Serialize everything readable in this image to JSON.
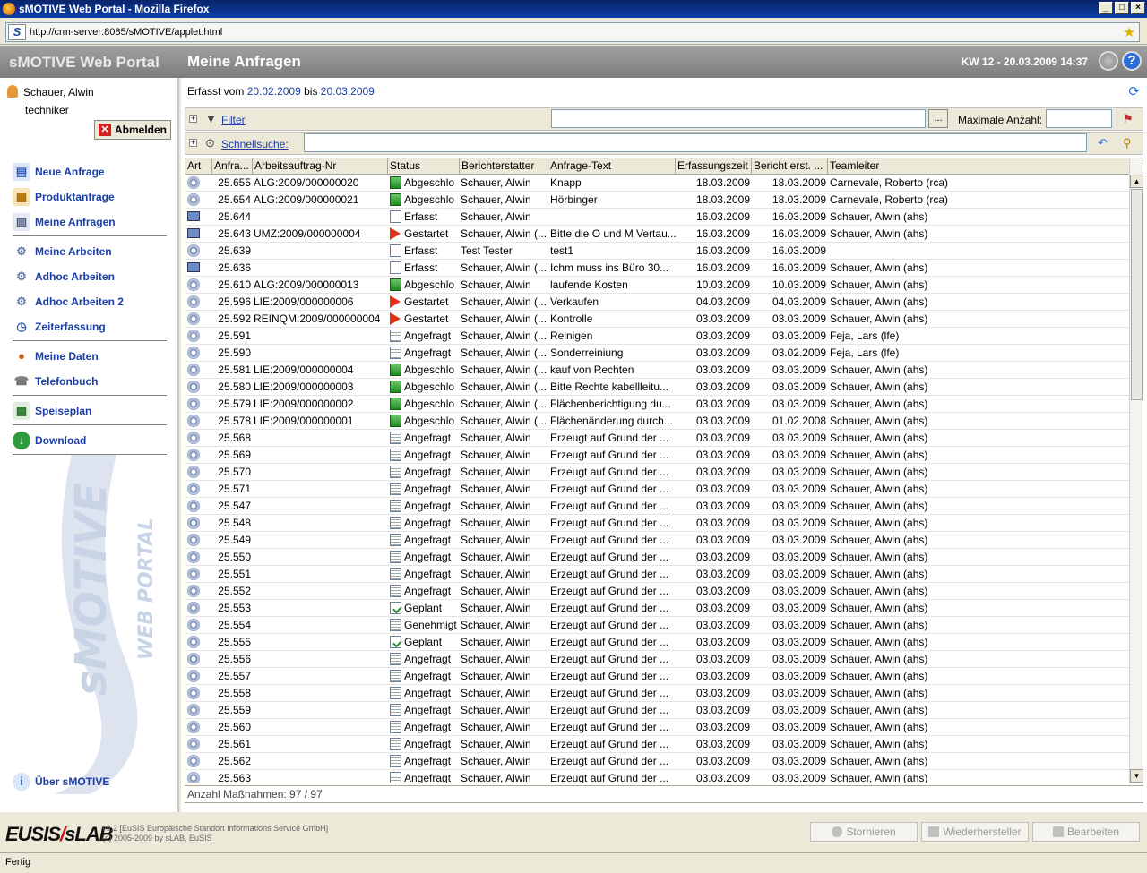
{
  "window": {
    "title": "sMOTIVE Web Portal - Mozilla Firefox"
  },
  "browser": {
    "url": "http://crm-server:8085/sMOTIVE/applet.html",
    "status": "Fertig"
  },
  "app": {
    "brand": "sMOTIVE Web Portal",
    "page_title": "Meine Anfragen",
    "date_info": "KW 12 - 20.03.2009 14:37"
  },
  "user": {
    "name": "Schauer, Alwin",
    "role": "techniker",
    "logout_label": "Abmelden"
  },
  "nav": [
    {
      "label": "Neue Anfrage",
      "icon": "new-request-icon"
    },
    {
      "label": "Produktanfrage",
      "icon": "product-request-icon"
    },
    {
      "label": "Meine Anfragen",
      "icon": "my-requests-icon"
    },
    {
      "label": "Meine Arbeiten",
      "icon": "gears-icon"
    },
    {
      "label": "Adhoc Arbeiten",
      "icon": "gears-icon"
    },
    {
      "label": "Adhoc Arbeiten 2",
      "icon": "gears-icon"
    },
    {
      "label": "Zeiterfassung",
      "icon": "clock-icon"
    },
    {
      "label": "Meine Daten",
      "icon": "person-icon"
    },
    {
      "label": "Telefonbuch",
      "icon": "phonebook-icon"
    },
    {
      "label": "Speiseplan",
      "icon": "menu-plan-icon"
    },
    {
      "label": "Download",
      "icon": "download-icon"
    }
  ],
  "about_label": "Über sMOTIVE",
  "range": {
    "prefix": "Erfasst vom",
    "from": "20.02.2009",
    "mid": "bis",
    "to": "20.03.2009"
  },
  "filter": {
    "label": "Filter",
    "browse": "...",
    "max_label": "Maximale Anzahl:",
    "max_value": ""
  },
  "quicksearch": {
    "label": "Schnellsuche:",
    "value": ""
  },
  "columns": [
    "Art",
    "Anfra...",
    "Arbeitsauftrag-Nr",
    "Status",
    "Berichterstatter",
    "Anfrage-Text",
    "Erfassungszeit",
    "Bericht erst. ...",
    "Teamleiter"
  ],
  "rows": [
    {
      "art": "gear",
      "nr": "25.655",
      "auftrag": "ALG:2009/000000020",
      "status_icon": "green",
      "status": "Abgeschlo",
      "reporter": "Schauer, Alwin",
      "text": "Knapp",
      "erfasst": "18.03.2009",
      "bericht": "18.03.2009",
      "leiter": "Carnevale, Roberto (rca)"
    },
    {
      "art": "gear",
      "nr": "25.654",
      "auftrag": "ALG:2009/000000021",
      "status_icon": "green",
      "status": "Abgeschlo",
      "reporter": "Schauer, Alwin",
      "text": "Hörbinger",
      "erfasst": "18.03.2009",
      "bericht": "18.03.2009",
      "leiter": "Carnevale, Roberto (rca)"
    },
    {
      "art": "pc",
      "nr": "25.644",
      "auftrag": "",
      "status_icon": "doc",
      "status": "Erfasst",
      "reporter": "Schauer, Alwin",
      "text": "",
      "erfasst": "16.03.2009",
      "bericht": "16.03.2009",
      "leiter": "Schauer, Alwin (ahs)"
    },
    {
      "art": "pc",
      "nr": "25.643",
      "auftrag": "UMZ:2009/000000004",
      "status_icon": "red",
      "status": "Gestartet",
      "reporter": "Schauer, Alwin (...",
      "text": "Bitte die O und M Vertau...",
      "erfasst": "16.03.2009",
      "bericht": "16.03.2009",
      "leiter": "Schauer, Alwin (ahs)"
    },
    {
      "art": "gear",
      "nr": "25.639",
      "auftrag": "",
      "status_icon": "doc",
      "status": "Erfasst",
      "reporter": "Test Tester",
      "text": "test1",
      "erfasst": "16.03.2009",
      "bericht": "16.03.2009",
      "leiter": ""
    },
    {
      "art": "pc",
      "nr": "25.636",
      "auftrag": "",
      "status_icon": "doc",
      "status": "Erfasst",
      "reporter": "Schauer, Alwin (...",
      "text": "Ichm muss ins Büro 30...",
      "erfasst": "16.03.2009",
      "bericht": "16.03.2009",
      "leiter": "Schauer, Alwin (ahs)"
    },
    {
      "art": "gear",
      "nr": "25.610",
      "auftrag": "ALG:2009/000000013",
      "status_icon": "green",
      "status": "Abgeschlo",
      "reporter": "Schauer, Alwin",
      "text": "laufende Kosten",
      "erfasst": "10.03.2009",
      "bericht": "10.03.2009",
      "leiter": "Schauer, Alwin (ahs)"
    },
    {
      "art": "gear",
      "nr": "25.596",
      "auftrag": "LIE:2009/000000006",
      "status_icon": "red",
      "status": "Gestartet",
      "reporter": "Schauer, Alwin (...",
      "text": "Verkaufen",
      "erfasst": "04.03.2009",
      "bericht": "04.03.2009",
      "leiter": "Schauer, Alwin (ahs)"
    },
    {
      "art": "gear",
      "nr": "25.592",
      "auftrag": "REINQM:2009/000000004",
      "status_icon": "red",
      "status": "Gestartet",
      "reporter": "Schauer, Alwin (...",
      "text": "Kontrolle",
      "erfasst": "03.03.2009",
      "bericht": "03.03.2009",
      "leiter": "Schauer, Alwin (ahs)"
    },
    {
      "art": "gear",
      "nr": "25.591",
      "auftrag": "",
      "status_icon": "lines",
      "status": "Angefragt",
      "reporter": "Schauer, Alwin (...",
      "text": "Reinigen",
      "erfasst": "03.03.2009",
      "bericht": "03.03.2009",
      "leiter": "Feja, Lars (lfe)"
    },
    {
      "art": "gear",
      "nr": "25.590",
      "auftrag": "",
      "status_icon": "lines",
      "status": "Angefragt",
      "reporter": "Schauer, Alwin (...",
      "text": "Sonderreiniung",
      "erfasst": "03.03.2009",
      "bericht": "03.02.2009",
      "leiter": "Feja, Lars (lfe)"
    },
    {
      "art": "gear",
      "nr": "25.581",
      "auftrag": "LIE:2009/000000004",
      "status_icon": "green",
      "status": "Abgeschlo",
      "reporter": "Schauer, Alwin (...",
      "text": "kauf von Rechten",
      "erfasst": "03.03.2009",
      "bericht": "03.03.2009",
      "leiter": "Schauer, Alwin (ahs)"
    },
    {
      "art": "gear",
      "nr": "25.580",
      "auftrag": "LIE:2009/000000003",
      "status_icon": "green",
      "status": "Abgeschlo",
      "reporter": "Schauer, Alwin (...",
      "text": "Bitte Rechte kabellleitu...",
      "erfasst": "03.03.2009",
      "bericht": "03.03.2009",
      "leiter": "Schauer, Alwin (ahs)"
    },
    {
      "art": "gear",
      "nr": "25.579",
      "auftrag": "LIE:2009/000000002",
      "status_icon": "green",
      "status": "Abgeschlo",
      "reporter": "Schauer, Alwin (...",
      "text": "Flächenberichtigung du...",
      "erfasst": "03.03.2009",
      "bericht": "03.03.2009",
      "leiter": "Schauer, Alwin (ahs)"
    },
    {
      "art": "gear",
      "nr": "25.578",
      "auftrag": "LIE:2009/000000001",
      "status_icon": "green",
      "status": "Abgeschlo",
      "reporter": "Schauer, Alwin (...",
      "text": "Flächenänderung durch...",
      "erfasst": "03.03.2009",
      "bericht": "01.02.2008",
      "leiter": "Schauer, Alwin (ahs)"
    },
    {
      "art": "gear",
      "nr": "25.568",
      "auftrag": "",
      "status_icon": "lines",
      "status": "Angefragt",
      "reporter": "Schauer, Alwin",
      "text": "Erzeugt auf Grund der ...",
      "erfasst": "03.03.2009",
      "bericht": "03.03.2009",
      "leiter": "Schauer, Alwin (ahs)"
    },
    {
      "art": "gear",
      "nr": "25.569",
      "auftrag": "",
      "status_icon": "lines",
      "status": "Angefragt",
      "reporter": "Schauer, Alwin",
      "text": "Erzeugt auf Grund der ...",
      "erfasst": "03.03.2009",
      "bericht": "03.03.2009",
      "leiter": "Schauer, Alwin (ahs)"
    },
    {
      "art": "gear",
      "nr": "25.570",
      "auftrag": "",
      "status_icon": "lines",
      "status": "Angefragt",
      "reporter": "Schauer, Alwin",
      "text": "Erzeugt auf Grund der ...",
      "erfasst": "03.03.2009",
      "bericht": "03.03.2009",
      "leiter": "Schauer, Alwin (ahs)"
    },
    {
      "art": "gear",
      "nr": "25.571",
      "auftrag": "",
      "status_icon": "lines",
      "status": "Angefragt",
      "reporter": "Schauer, Alwin",
      "text": "Erzeugt auf Grund der ...",
      "erfasst": "03.03.2009",
      "bericht": "03.03.2009",
      "leiter": "Schauer, Alwin (ahs)"
    },
    {
      "art": "gear",
      "nr": "25.547",
      "auftrag": "",
      "status_icon": "lines",
      "status": "Angefragt",
      "reporter": "Schauer, Alwin",
      "text": "Erzeugt auf Grund der ...",
      "erfasst": "03.03.2009",
      "bericht": "03.03.2009",
      "leiter": "Schauer, Alwin (ahs)"
    },
    {
      "art": "gear",
      "nr": "25.548",
      "auftrag": "",
      "status_icon": "lines",
      "status": "Angefragt",
      "reporter": "Schauer, Alwin",
      "text": "Erzeugt auf Grund der ...",
      "erfasst": "03.03.2009",
      "bericht": "03.03.2009",
      "leiter": "Schauer, Alwin (ahs)"
    },
    {
      "art": "gear",
      "nr": "25.549",
      "auftrag": "",
      "status_icon": "lines",
      "status": "Angefragt",
      "reporter": "Schauer, Alwin",
      "text": "Erzeugt auf Grund der ...",
      "erfasst": "03.03.2009",
      "bericht": "03.03.2009",
      "leiter": "Schauer, Alwin (ahs)"
    },
    {
      "art": "gear",
      "nr": "25.550",
      "auftrag": "",
      "status_icon": "lines",
      "status": "Angefragt",
      "reporter": "Schauer, Alwin",
      "text": "Erzeugt auf Grund der ...",
      "erfasst": "03.03.2009",
      "bericht": "03.03.2009",
      "leiter": "Schauer, Alwin (ahs)"
    },
    {
      "art": "gear",
      "nr": "25.551",
      "auftrag": "",
      "status_icon": "lines",
      "status": "Angefragt",
      "reporter": "Schauer, Alwin",
      "text": "Erzeugt auf Grund der ...",
      "erfasst": "03.03.2009",
      "bericht": "03.03.2009",
      "leiter": "Schauer, Alwin (ahs)"
    },
    {
      "art": "gear",
      "nr": "25.552",
      "auftrag": "",
      "status_icon": "lines",
      "status": "Angefragt",
      "reporter": "Schauer, Alwin",
      "text": "Erzeugt auf Grund der ...",
      "erfasst": "03.03.2009",
      "bericht": "03.03.2009",
      "leiter": "Schauer, Alwin (ahs)"
    },
    {
      "art": "gear",
      "nr": "25.553",
      "auftrag": "",
      "status_icon": "plan",
      "status": "Geplant",
      "reporter": "Schauer, Alwin",
      "text": "Erzeugt auf Grund der ...",
      "erfasst": "03.03.2009",
      "bericht": "03.03.2009",
      "leiter": "Schauer, Alwin (ahs)"
    },
    {
      "art": "gear",
      "nr": "25.554",
      "auftrag": "",
      "status_icon": "lines",
      "status": "Genehmigt",
      "reporter": "Schauer, Alwin",
      "text": "Erzeugt auf Grund der ...",
      "erfasst": "03.03.2009",
      "bericht": "03.03.2009",
      "leiter": "Schauer, Alwin (ahs)"
    },
    {
      "art": "gear",
      "nr": "25.555",
      "auftrag": "",
      "status_icon": "plan",
      "status": "Geplant",
      "reporter": "Schauer, Alwin",
      "text": "Erzeugt auf Grund der ...",
      "erfasst": "03.03.2009",
      "bericht": "03.03.2009",
      "leiter": "Schauer, Alwin (ahs)"
    },
    {
      "art": "gear",
      "nr": "25.556",
      "auftrag": "",
      "status_icon": "lines",
      "status": "Angefragt",
      "reporter": "Schauer, Alwin",
      "text": "Erzeugt auf Grund der ...",
      "erfasst": "03.03.2009",
      "bericht": "03.03.2009",
      "leiter": "Schauer, Alwin (ahs)"
    },
    {
      "art": "gear",
      "nr": "25.557",
      "auftrag": "",
      "status_icon": "lines",
      "status": "Angefragt",
      "reporter": "Schauer, Alwin",
      "text": "Erzeugt auf Grund der ...",
      "erfasst": "03.03.2009",
      "bericht": "03.03.2009",
      "leiter": "Schauer, Alwin (ahs)"
    },
    {
      "art": "gear",
      "nr": "25.558",
      "auftrag": "",
      "status_icon": "lines",
      "status": "Angefragt",
      "reporter": "Schauer, Alwin",
      "text": "Erzeugt auf Grund der ...",
      "erfasst": "03.03.2009",
      "bericht": "03.03.2009",
      "leiter": "Schauer, Alwin (ahs)"
    },
    {
      "art": "gear",
      "nr": "25.559",
      "auftrag": "",
      "status_icon": "lines",
      "status": "Angefragt",
      "reporter": "Schauer, Alwin",
      "text": "Erzeugt auf Grund der ...",
      "erfasst": "03.03.2009",
      "bericht": "03.03.2009",
      "leiter": "Schauer, Alwin (ahs)"
    },
    {
      "art": "gear",
      "nr": "25.560",
      "auftrag": "",
      "status_icon": "lines",
      "status": "Angefragt",
      "reporter": "Schauer, Alwin",
      "text": "Erzeugt auf Grund der ...",
      "erfasst": "03.03.2009",
      "bericht": "03.03.2009",
      "leiter": "Schauer, Alwin (ahs)"
    },
    {
      "art": "gear",
      "nr": "25.561",
      "auftrag": "",
      "status_icon": "lines",
      "status": "Angefragt",
      "reporter": "Schauer, Alwin",
      "text": "Erzeugt auf Grund der ...",
      "erfasst": "03.03.2009",
      "bericht": "03.03.2009",
      "leiter": "Schauer, Alwin (ahs)"
    },
    {
      "art": "gear",
      "nr": "25.562",
      "auftrag": "",
      "status_icon": "lines",
      "status": "Angefragt",
      "reporter": "Schauer, Alwin",
      "text": "Erzeugt auf Grund der ...",
      "erfasst": "03.03.2009",
      "bericht": "03.03.2009",
      "leiter": "Schauer, Alwin (ahs)"
    },
    {
      "art": "gear",
      "nr": "25.563",
      "auftrag": "",
      "status_icon": "lines",
      "status": "Angefragt",
      "reporter": "Schauer, Alwin",
      "text": "Erzeugt auf Grund der ...",
      "erfasst": "03.03.2009",
      "bericht": "03.03.2009",
      "leiter": "Schauer, Alwin (ahs)"
    }
  ],
  "count_label": "Anzahl Maßnahmen: 97 / 97",
  "footer": {
    "logo_left": "EUSIS",
    "logo_right": "sLAB",
    "version_line1": "v9.2 [EuSIS Europäische Standort Informations Service GmbH]",
    "version_line2": "(c) 2005-2009 by sLAB, EuSIS",
    "buttons": [
      {
        "label": "Stornieren",
        "icon": "cancel-icon"
      },
      {
        "label": "Wiederhersteller",
        "icon": "restore-icon"
      },
      {
        "label": "Bearbeiten",
        "icon": "edit-icon"
      }
    ]
  },
  "watermark": {
    "line1": "sMOTIVE",
    "line2": "WEB PORTAL"
  }
}
